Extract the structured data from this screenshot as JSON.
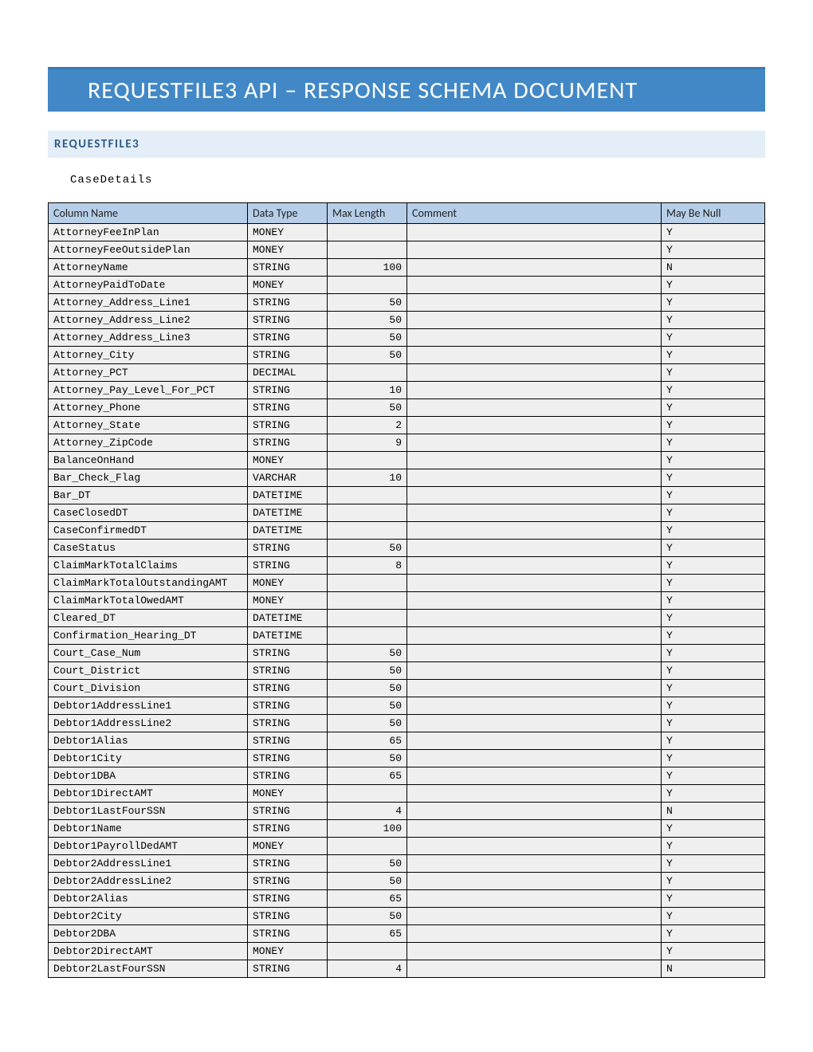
{
  "title": "REQUESTFILE3 API – RESPONSE SCHEMA DOCUMENT",
  "section": "REQUESTFILE3",
  "subsection": "CaseDetails",
  "headers": {
    "col_name": "Column Name",
    "data_type": "Data Type",
    "max_len": "Max Length",
    "comment": "Comment",
    "may_be_null": "May Be Null"
  },
  "rows": [
    {
      "name": "AttorneyFeeInPlan",
      "type": "MONEY",
      "len": "",
      "comment": "",
      "null": "Y"
    },
    {
      "name": "AttorneyFeeOutsidePlan",
      "type": "MONEY",
      "len": "",
      "comment": "",
      "null": "Y"
    },
    {
      "name": "AttorneyName",
      "type": "STRING",
      "len": "100",
      "comment": "",
      "null": "N"
    },
    {
      "name": "AttorneyPaidToDate",
      "type": "MONEY",
      "len": "",
      "comment": "",
      "null": "Y"
    },
    {
      "name": "Attorney_Address_Line1",
      "type": "STRING",
      "len": "50",
      "comment": "",
      "null": "Y"
    },
    {
      "name": "Attorney_Address_Line2",
      "type": "STRING",
      "len": "50",
      "comment": "",
      "null": "Y"
    },
    {
      "name": "Attorney_Address_Line3",
      "type": "STRING",
      "len": "50",
      "comment": "",
      "null": "Y"
    },
    {
      "name": "Attorney_City",
      "type": "STRING",
      "len": "50",
      "comment": "",
      "null": "Y"
    },
    {
      "name": "Attorney_PCT",
      "type": "DECIMAL",
      "len": "",
      "comment": "",
      "null": "Y"
    },
    {
      "name": "Attorney_Pay_Level_For_PCT",
      "type": "STRING",
      "len": "10",
      "comment": "",
      "null": "Y"
    },
    {
      "name": "Attorney_Phone",
      "type": "STRING",
      "len": "50",
      "comment": "",
      "null": "Y"
    },
    {
      "name": "Attorney_State",
      "type": "STRING",
      "len": "2",
      "comment": "",
      "null": "Y"
    },
    {
      "name": "Attorney_ZipCode",
      "type": "STRING",
      "len": "9",
      "comment": "",
      "null": "Y"
    },
    {
      "name": "BalanceOnHand",
      "type": "MONEY",
      "len": "",
      "comment": "",
      "null": "Y"
    },
    {
      "name": "Bar_Check_Flag",
      "type": "VARCHAR",
      "len": "10",
      "comment": "",
      "null": "Y"
    },
    {
      "name": "Bar_DT",
      "type": "DATETIME",
      "len": "",
      "comment": "",
      "null": "Y"
    },
    {
      "name": "CaseClosedDT",
      "type": "DATETIME",
      "len": "",
      "comment": "",
      "null": "Y"
    },
    {
      "name": "CaseConfirmedDT",
      "type": "DATETIME",
      "len": "",
      "comment": "",
      "null": "Y"
    },
    {
      "name": "CaseStatus",
      "type": "STRING",
      "len": "50",
      "comment": "",
      "null": "Y"
    },
    {
      "name": "ClaimMarkTotalClaims",
      "type": "STRING",
      "len": "8",
      "comment": "",
      "null": "Y"
    },
    {
      "name": "ClaimMarkTotalOutstandingAMT",
      "type": "MONEY",
      "len": "",
      "comment": "",
      "null": "Y"
    },
    {
      "name": "ClaimMarkTotalOwedAMT",
      "type": "MONEY",
      "len": "",
      "comment": "",
      "null": "Y"
    },
    {
      "name": "Cleared_DT",
      "type": "DATETIME",
      "len": "",
      "comment": "",
      "null": "Y"
    },
    {
      "name": "Confirmation_Hearing_DT",
      "type": "DATETIME",
      "len": "",
      "comment": "",
      "null": "Y"
    },
    {
      "name": "Court_Case_Num",
      "type": "STRING",
      "len": "50",
      "comment": "",
      "null": "Y"
    },
    {
      "name": "Court_District",
      "type": "STRING",
      "len": "50",
      "comment": "",
      "null": "Y"
    },
    {
      "name": "Court_Division",
      "type": "STRING",
      "len": "50",
      "comment": "",
      "null": "Y"
    },
    {
      "name": "Debtor1AddressLine1",
      "type": "STRING",
      "len": "50",
      "comment": "",
      "null": "Y"
    },
    {
      "name": "Debtor1AddressLine2",
      "type": "STRING",
      "len": "50",
      "comment": "",
      "null": "Y"
    },
    {
      "name": "Debtor1Alias",
      "type": "STRING",
      "len": "65",
      "comment": "",
      "null": "Y"
    },
    {
      "name": "Debtor1City",
      "type": "STRING",
      "len": "50",
      "comment": "",
      "null": "Y"
    },
    {
      "name": "Debtor1DBA",
      "type": "STRING",
      "len": "65",
      "comment": "",
      "null": "Y"
    },
    {
      "name": "Debtor1DirectAMT",
      "type": "MONEY",
      "len": "",
      "comment": "",
      "null": "Y"
    },
    {
      "name": "Debtor1LastFourSSN",
      "type": "STRING",
      "len": "4",
      "comment": "",
      "null": "N"
    },
    {
      "name": "Debtor1Name",
      "type": "STRING",
      "len": "100",
      "comment": "",
      "null": "Y"
    },
    {
      "name": "Debtor1PayrollDedAMT",
      "type": "MONEY",
      "len": "",
      "comment": "",
      "null": "Y"
    },
    {
      "name": "Debtor2AddressLine1",
      "type": "STRING",
      "len": "50",
      "comment": "",
      "null": "Y"
    },
    {
      "name": "Debtor2AddressLine2",
      "type": "STRING",
      "len": "50",
      "comment": "",
      "null": "Y"
    },
    {
      "name": "Debtor2Alias",
      "type": "STRING",
      "len": "65",
      "comment": "",
      "null": "Y"
    },
    {
      "name": "Debtor2City",
      "type": "STRING",
      "len": "50",
      "comment": "",
      "null": "Y"
    },
    {
      "name": "Debtor2DBA",
      "type": "STRING",
      "len": "65",
      "comment": "",
      "null": "Y"
    },
    {
      "name": "Debtor2DirectAMT",
      "type": "MONEY",
      "len": "",
      "comment": "",
      "null": "Y"
    },
    {
      "name": "Debtor2LastFourSSN",
      "type": "STRING",
      "len": "4",
      "comment": "",
      "null": "N"
    }
  ]
}
